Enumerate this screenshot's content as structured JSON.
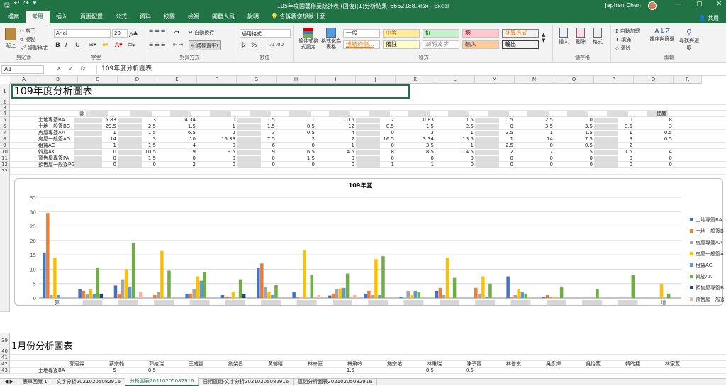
{
  "titlebar": {
    "qat_icons": [
      "save-icon",
      "undo-icon",
      "redo-icon",
      "customize-icon"
    ],
    "doc_title": "105年度園藝作業統計表 (回復)(1)分析結果_6662188.xlsx - Excel",
    "user": "Japhen Chen",
    "win_min": "—",
    "win_max": "▢",
    "win_close": "✕"
  },
  "tabs": {
    "items": [
      {
        "label": "檔案"
      },
      {
        "label": "常用"
      },
      {
        "label": "插入"
      },
      {
        "label": "頁面配置"
      },
      {
        "label": "公式"
      },
      {
        "label": "資料"
      },
      {
        "label": "校閱"
      },
      {
        "label": "檢視"
      },
      {
        "label": "開發人員"
      },
      {
        "label": "說明"
      }
    ],
    "tellme": "告訴我您想做什麼",
    "share": "共用"
  },
  "ribbon": {
    "clipboard": {
      "paste": "貼上",
      "cut": "剪下",
      "copy": "複製",
      "painter": "複製格式",
      "label": "剪貼簿"
    },
    "font": {
      "name": "Arial",
      "size": "20",
      "bold": "B",
      "italic": "I",
      "underline": "U",
      "label": "字型"
    },
    "align": {
      "wrap": "自動換行",
      "merge": "跨欄置中",
      "label": "對齊方式"
    },
    "number": {
      "format": "通用格式",
      "currency": "$",
      "percent": "%",
      "comma": ",",
      "label": "數值"
    },
    "styles": {
      "cond": "條件式格式設定",
      "table": "格式化為表格",
      "cells": [
        "一般",
        "中等",
        "好",
        "壞",
        "計算方式",
        "連結的儲...",
        "備註",
        "說明文字",
        "輸入",
        "輸出"
      ],
      "label": "樣式"
    },
    "cellsgrp": {
      "insert": "插入",
      "delete": "刪除",
      "format": "格式",
      "label": "儲存格"
    },
    "editing": {
      "autosum": "自動加總",
      "fill": "填滿",
      "clear": "清除",
      "sort": "排序與篩選",
      "find": "尋找與選取",
      "label": "編輯"
    }
  },
  "formulabar": {
    "namebox": "A1",
    "cancel": "✕",
    "enter": "✓",
    "fx": "fx",
    "formula": "109年度分析圖表"
  },
  "grid": {
    "columns": [
      "A",
      "B",
      "C",
      "D",
      "E",
      "F",
      "G",
      "H",
      "I",
      "J",
      "K",
      "L",
      "M",
      "N",
      "O",
      "P",
      "Q",
      "R"
    ],
    "rows": [
      "1",
      "2",
      "3",
      "4",
      "5",
      "6",
      "7",
      "8",
      "9",
      "10",
      "11",
      "12",
      "13",
      "14",
      "15",
      "16",
      "17",
      "18",
      "19",
      "20",
      "21",
      "22",
      "23",
      "24",
      "25",
      "26",
      "27",
      "28",
      "29",
      "30",
      "31",
      "32",
      "33",
      "34",
      "35",
      "36",
      "37",
      "38",
      "39",
      "40",
      "41",
      "42",
      "43"
    ],
    "title": "109年度分析圖表",
    "row4_first": "郭",
    "row4_last": "佳慶",
    "row_labels": [
      "土地專簽BA",
      "土地一般簽BG",
      "房屋專簽AA",
      "房屋一般簽AG",
      "租賃AC",
      "斡旋AK",
      "預售屋專簽PA",
      "預售屋一般簽PG"
    ],
    "table": [
      [
        "15.83",
        "3",
        "4.34",
        "0",
        "1.5",
        "1",
        "10.5",
        "2",
        "0.83",
        "1.5",
        "0.5",
        "2.5",
        "0",
        "0",
        "8"
      ],
      [
        "29.5",
        "2.5",
        "1.5",
        "1",
        "1.5",
        "0.5",
        "12",
        "0.5",
        "1.5",
        "2.5",
        "0",
        "3.5",
        "3.5",
        "0.5",
        "3"
      ],
      [
        "1",
        "1.5",
        "6.5",
        "2",
        "3",
        "0.5",
        "4",
        "0",
        "3",
        "1",
        "2.5",
        "1",
        "1.5",
        "1",
        "0.5"
      ],
      [
        "14",
        "3",
        "10",
        "16.33",
        "7.5",
        "2",
        "2",
        "16.5",
        "3.34",
        "13.5",
        "1",
        "14",
        "7.5",
        "3",
        "0.5"
      ],
      [
        "1",
        "1.5",
        "4",
        "0",
        "6",
        "0",
        "1",
        "0",
        "3.5",
        "1",
        "2.5",
        "0",
        "0.5",
        "2",
        ""
      ],
      [
        "0",
        "10.5",
        "19",
        "9.5",
        "9",
        "6.5",
        "4.5",
        "8",
        "8.5",
        "14.5",
        "2",
        "7",
        "5",
        "1.5",
        "4"
      ],
      [
        "0",
        "1.5",
        "0",
        "0",
        "0",
        "1.5",
        "0",
        "0",
        "0",
        "0",
        "0",
        "0",
        "0",
        "0",
        "0"
      ],
      [
        "0",
        "0",
        "2",
        "0",
        "0",
        "0",
        "0",
        "1",
        "1",
        "0",
        "0",
        "0",
        "0",
        "0",
        "0"
      ]
    ],
    "section2_title": "1月份分析圖表",
    "row42_names": [
      "郭冠霖",
      "蔡宗翰",
      "郭綾瑞",
      "王威霆",
      "劉榮昌",
      "黃郁晴",
      "林卉庭",
      "林飛吟",
      "施宗佑",
      "林秉瑞",
      "陳子晉",
      "林修玄",
      "吳彥輝",
      "吳怡萱",
      "韓昀捷",
      "林家萱"
    ],
    "row43_label": "土地專簽BA",
    "row43_values": [
      "5",
      "0.5",
      "",
      "",
      "",
      "",
      "1.5",
      "",
      "0.5",
      "0.5",
      "",
      "",
      "",
      "",
      "",
      ""
    ]
  },
  "chart_data": {
    "type": "bar",
    "title": "109年度",
    "xlabel": "",
    "ylabel": "",
    "ylim": [
      0,
      35
    ],
    "yticks": [
      "0",
      "5",
      "10",
      "15",
      "20",
      "25",
      "30",
      "35"
    ],
    "grid": true,
    "legend": "right",
    "categories": [
      "郭",
      "",
      "",
      "",
      "",
      "",
      "",
      "",
      "",
      "",
      "",
      "",
      "",
      "",
      "",
      "",
      "",
      "增"
    ],
    "colors": [
      "#4472c4",
      "#ed7d31",
      "#a5a5a5",
      "#ffc000",
      "#5b9bd5",
      "#70ad47",
      "#264478",
      "#f4b6a0"
    ],
    "series": [
      {
        "name": "土地專簽BA",
        "values": [
          15.83,
          3,
          4.34,
          0,
          1.5,
          1,
          10.5,
          2,
          0.83,
          1.5,
          0.5,
          2.5,
          0,
          7.5,
          0.5,
          0,
          0,
          0
        ]
      },
      {
        "name": "土地一般簽BG",
        "values": [
          29.5,
          2.5,
          1.5,
          1,
          1.5,
          0.5,
          12,
          0.5,
          1.5,
          2.5,
          0,
          3.5,
          3.5,
          0.5,
          1,
          0,
          0,
          0
        ]
      },
      {
        "name": "房屋專簽AA",
        "values": [
          1,
          1.5,
          6.5,
          2,
          3,
          0.5,
          4,
          0,
          3,
          1,
          2.5,
          1,
          1.5,
          1,
          0.5,
          0,
          0,
          0
        ]
      },
      {
        "name": "房屋一般簽AG",
        "values": [
          14,
          3,
          10,
          16.33,
          7.5,
          2,
          2,
          16.5,
          3.34,
          13.5,
          1,
          14,
          7.5,
          3,
          0.5,
          0,
          0,
          5
        ]
      },
      {
        "name": "租賃AC",
        "values": [
          1,
          1.5,
          4,
          0,
          6,
          0,
          1,
          0,
          3.5,
          1,
          2.5,
          0,
          0.5,
          2,
          0,
          0,
          0,
          0
        ]
      },
      {
        "name": "斡旋AK",
        "values": [
          0,
          10.5,
          19,
          9.5,
          9,
          6.5,
          4.5,
          8,
          8.5,
          14.5,
          2,
          7,
          5,
          1.5,
          4,
          3,
          8,
          1.5
        ]
      },
      {
        "name": "預售屋專簽PA",
        "values": [
          0,
          1.5,
          0,
          0,
          0,
          1.5,
          0,
          0,
          0,
          0,
          0,
          0,
          0,
          0,
          0,
          0,
          0,
          0
        ]
      },
      {
        "name": "預售屋一般簽PG",
        "values": [
          0,
          0,
          2,
          0,
          0,
          0,
          0,
          1,
          1,
          0,
          0,
          0,
          0,
          0,
          0,
          0,
          0,
          0
        ]
      }
    ]
  },
  "sheettabs": [
    "表單回應 1",
    "文字分析20210205082916",
    "分析圖表20210205082916",
    "日期區間-文字分析20210205082916",
    "區間分析圖表20210205082916"
  ],
  "active_sheet_index": 2
}
